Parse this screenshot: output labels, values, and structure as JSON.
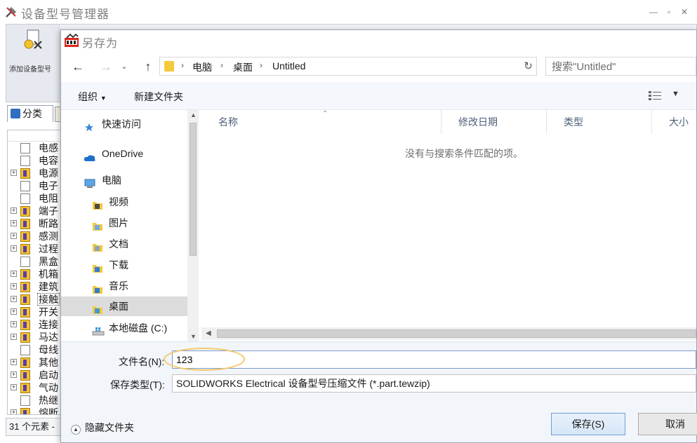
{
  "background_window": {
    "title": "设备型号管理器",
    "ribbon_add_button_label": "添加设备型号",
    "tab_category": "分类",
    "tree_items": [
      {
        "label": "电感",
        "expandable": false,
        "icon": "document-icon"
      },
      {
        "label": "电容",
        "expandable": false,
        "icon": "document-icon"
      },
      {
        "label": "电源",
        "expandable": true,
        "icon": "library-icon"
      },
      {
        "label": "电子",
        "expandable": false,
        "icon": "document-icon"
      },
      {
        "label": "电阻",
        "expandable": false,
        "icon": "document-icon"
      },
      {
        "label": "端子",
        "expandable": true,
        "icon": "library-icon"
      },
      {
        "label": "断路",
        "expandable": true,
        "icon": "library-icon"
      },
      {
        "label": "感测",
        "expandable": true,
        "icon": "library-icon"
      },
      {
        "label": "过程",
        "expandable": true,
        "icon": "library-icon"
      },
      {
        "label": "黑盒",
        "expandable": false,
        "icon": "document-icon"
      },
      {
        "label": "机箱",
        "expandable": true,
        "icon": "library-icon"
      },
      {
        "label": "建筑",
        "expandable": true,
        "icon": "library-icon"
      },
      {
        "label": "接触",
        "expandable": true,
        "icon": "library-icon",
        "selected": true
      },
      {
        "label": "开关",
        "expandable": true,
        "icon": "library-icon"
      },
      {
        "label": "连接",
        "expandable": true,
        "icon": "library-icon"
      },
      {
        "label": "马达",
        "expandable": true,
        "icon": "library-icon"
      },
      {
        "label": "母线",
        "expandable": false,
        "icon": "document-icon"
      },
      {
        "label": "其他",
        "expandable": true,
        "icon": "library-icon"
      },
      {
        "label": "启动",
        "expandable": true,
        "icon": "library-icon"
      },
      {
        "label": "气动",
        "expandable": true,
        "icon": "library-icon"
      },
      {
        "label": "热继",
        "expandable": false,
        "icon": "document-icon"
      },
      {
        "label": "熔断",
        "expandable": true,
        "icon": "library-icon"
      }
    ],
    "status_text": "31 个元素 -"
  },
  "dialog": {
    "title": "另存为",
    "breadcrumbs": [
      "电脑",
      "桌面",
      "Untitled"
    ],
    "search_placeholder": "搜索\"Untitled\"",
    "toolbar": {
      "organize_label": "组织",
      "new_folder_label": "新建文件夹"
    },
    "nav_items": [
      {
        "label": "快速访问",
        "icon": "star-icon",
        "indent": 0
      },
      {
        "label": "OneDrive",
        "icon": "cloud-icon",
        "indent": 0
      },
      {
        "label": "电脑",
        "icon": "computer-icon",
        "indent": 0
      },
      {
        "label": "视频",
        "icon": "video-folder-icon",
        "indent": 1
      },
      {
        "label": "图片",
        "icon": "pictures-folder-icon",
        "indent": 1
      },
      {
        "label": "文档",
        "icon": "documents-folder-icon",
        "indent": 1
      },
      {
        "label": "下载",
        "icon": "downloads-folder-icon",
        "indent": 1
      },
      {
        "label": "音乐",
        "icon": "music-folder-icon",
        "indent": 1
      },
      {
        "label": "桌面",
        "icon": "desktop-folder-icon",
        "indent": 1,
        "selected": true
      },
      {
        "label": "本地磁盘 (C:)",
        "icon": "drive-icon",
        "indent": 1
      }
    ],
    "columns": [
      "名称",
      "修改日期",
      "类型",
      "大小"
    ],
    "empty_message": "没有与搜索条件匹配的项。",
    "filename_label": "文件名(N):",
    "filename_value": "123",
    "filetype_label": "保存类型(T):",
    "filetype_value": "SOLIDWORKS Electrical 设备型号压缩文件 (*.part.tewzip)",
    "hide_folders_label": "隐藏文件夹",
    "save_button": "保存(S)",
    "cancel_button": "取消"
  },
  "colors": {
    "accent_blue": "#2f6fbe",
    "selection_gray": "#dcdcdc",
    "highlight_ring": "#f2c86a",
    "folder_yellow": "#f4c93c"
  }
}
